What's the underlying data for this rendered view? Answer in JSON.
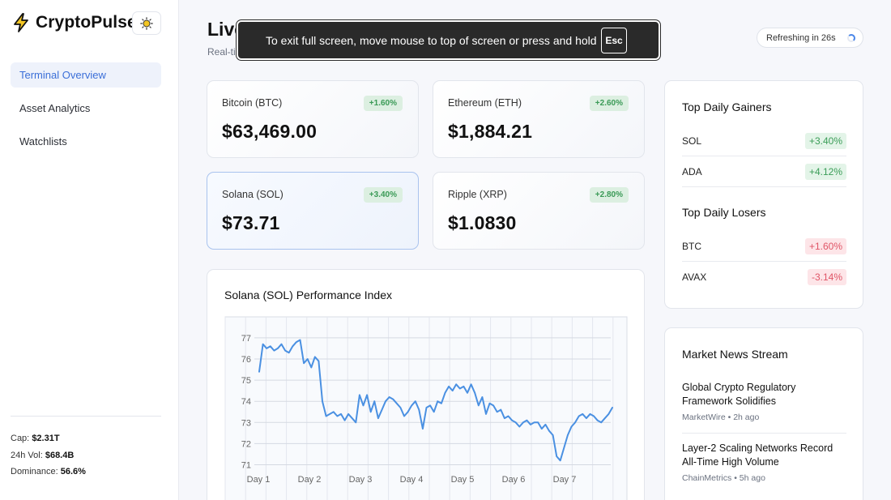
{
  "brand": {
    "name": "CryptoPulse",
    "icon": "lightning-bolt-icon",
    "theme_icon": "sun-icon"
  },
  "nav": [
    {
      "label": "Terminal Overview",
      "active": true
    },
    {
      "label": "Asset Analytics",
      "active": false
    },
    {
      "label": "Watchlists",
      "active": false
    }
  ],
  "stats": {
    "cap_label": "Cap:",
    "cap_value": "$2.31T",
    "vol_label": "24h Vol:",
    "vol_value": "$68.4B",
    "dom_label": "Dominance:",
    "dom_value": "56.6%"
  },
  "header": {
    "title": "Live",
    "subtitle": "Real-ti",
    "refresh_label": "Refreshing in 26s"
  },
  "fullscreen_notice": {
    "text": "To exit full screen, move mouse to top of screen or press and hold",
    "key": "Esc"
  },
  "coins": [
    {
      "name": "Bitcoin (BTC)",
      "price": "$63,469.00",
      "change": "+1.60%"
    },
    {
      "name": "Ethereum (ETH)",
      "price": "$1,884.21",
      "change": "+2.60%"
    },
    {
      "name": "Solana (SOL)",
      "price": "$73.71",
      "change": "+3.40%"
    },
    {
      "name": "Ripple (XRP)",
      "price": "$1.0830",
      "change": "+2.80%"
    }
  ],
  "gainers": {
    "title": "Top Daily Gainers",
    "items": [
      {
        "symbol": "SOL",
        "change": "+3.40%"
      },
      {
        "symbol": "ADA",
        "change": "+4.12%"
      }
    ]
  },
  "losers": {
    "title": "Top Daily Losers",
    "items": [
      {
        "symbol": "BTC",
        "change": "+1.60%"
      },
      {
        "symbol": "AVAX",
        "change": "-3.14%"
      }
    ]
  },
  "news": {
    "title": "Market News Stream",
    "items": [
      {
        "headline": "Global Crypto Regulatory Framework Solidifies",
        "source": "MarketWire",
        "time": "2h ago"
      },
      {
        "headline": "Layer-2 Scaling Networks Record All-Time High Volume",
        "source": "ChainMetrics",
        "time": "5h ago"
      }
    ]
  },
  "colors": {
    "accent": "#3b6fd8",
    "line": "#4a90e2",
    "up": "#3b9d58",
    "down": "#e05567"
  },
  "chart_data": {
    "type": "line",
    "title": "Solana (SOL) Performance Index",
    "xlabel": "",
    "ylabel": "",
    "x_tick_labels": [
      "Day 1",
      "Day 2",
      "Day 3",
      "Day 4",
      "Day 5",
      "Day 6",
      "Day 7"
    ],
    "y_ticks": [
      71,
      72,
      73,
      74,
      75,
      76,
      77
    ],
    "ylim": [
      70.6,
      77.5
    ],
    "grid": true,
    "series": [
      {
        "values": [
          75.4,
          76.7,
          76.5,
          76.6,
          76.4,
          76.5,
          76.7,
          76.4,
          76.3,
          76.6,
          76.8,
          76.9,
          75.8,
          76.0,
          75.6,
          76.1,
          75.9,
          74.0,
          73.3,
          73.4,
          73.5,
          73.3,
          73.4,
          73.1,
          73.4,
          73.2,
          73.0,
          74.3,
          73.8,
          74.3,
          73.5,
          74.0,
          73.2,
          73.6,
          74.0,
          74.2,
          74.1,
          73.9,
          73.7,
          73.3,
          73.5,
          73.8,
          74.0,
          73.6,
          72.7,
          73.7,
          73.8,
          73.5,
          74.0,
          73.9,
          74.4,
          74.7,
          74.5,
          74.8,
          74.6,
          74.7,
          74.4,
          74.8,
          74.4,
          73.8,
          74.2,
          73.4,
          73.9,
          73.8,
          73.5,
          73.6,
          73.2,
          73.3,
          73.1,
          73.0,
          72.8,
          73.0,
          73.1,
          72.9,
          73.0,
          73.0,
          72.7,
          72.9,
          72.6,
          72.4,
          71.4,
          71.2,
          71.8,
          72.4,
          72.8,
          73.0,
          73.3,
          73.4,
          73.2,
          73.4,
          73.3,
          73.1,
          73.0,
          73.2,
          73.4,
          73.7
        ]
      }
    ]
  }
}
